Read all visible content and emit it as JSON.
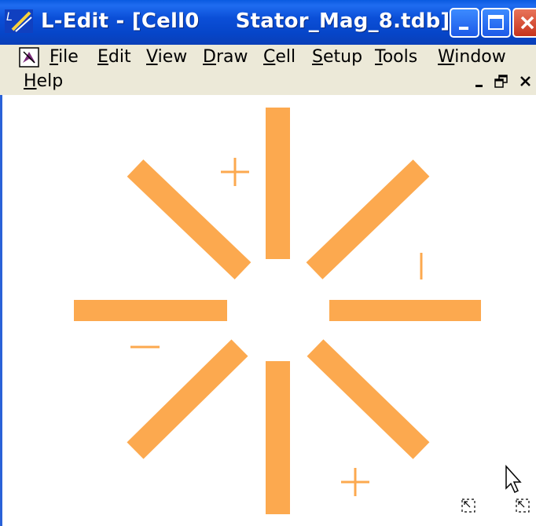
{
  "window": {
    "title": "L-Edit - [Cell0     Stator_Mag_8.tdb]"
  },
  "menu": {
    "items": [
      {
        "label": "File",
        "accel": "F",
        "rest": "ile"
      },
      {
        "label": "Edit",
        "accel": "E",
        "rest": "dit"
      },
      {
        "label": "View",
        "accel": "V",
        "rest": "iew"
      },
      {
        "label": "Draw",
        "accel": "D",
        "rest": "raw"
      },
      {
        "label": "Cell",
        "accel": "C",
        "rest": "ell"
      },
      {
        "label": "Setup",
        "accel": "S",
        "rest": "etup"
      },
      {
        "label": "Tools",
        "accel": "T",
        "rest": "ools"
      },
      {
        "label": "Window",
        "accel": "W",
        "rest": "indow"
      },
      {
        "label": "Help",
        "accel": "H",
        "rest": "elp"
      }
    ]
  },
  "layout_elements": {
    "stator_poles": 8,
    "pole_color": "#fca94f",
    "labels": [
      "+",
      "|",
      "-",
      "+"
    ]
  },
  "colors": {
    "titlebar": "#0b4fd8",
    "menubar": "#ece9d8",
    "accent": "#fca94f"
  },
  "icons": [
    "app-icon",
    "document-icon",
    "minimize-icon",
    "maximize-icon",
    "close-icon",
    "restore-icon",
    "mouse-pointer-icon",
    "selection-handle-icon"
  ]
}
